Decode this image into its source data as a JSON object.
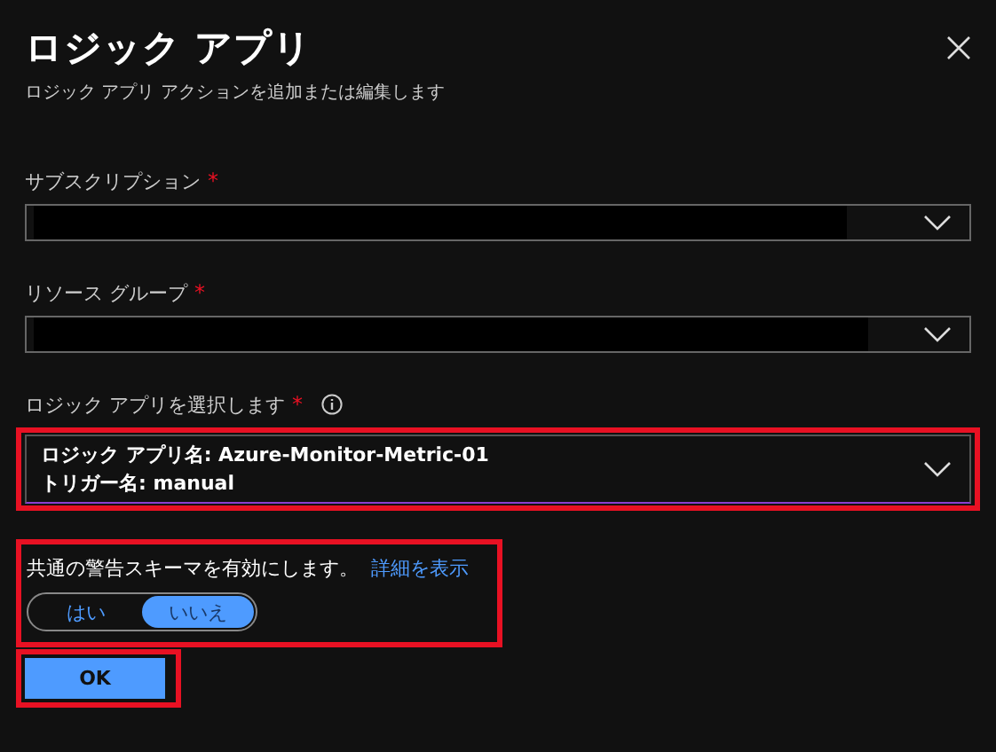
{
  "panel": {
    "title": "ロジック アプリ",
    "subtitle": "ロジック アプリ アクションを追加または編集します"
  },
  "fields": [
    {
      "label": "サブスクリプション",
      "required": "*",
      "redacted": true
    },
    {
      "label": "リソース グループ",
      "required": "*",
      "redacted": true
    },
    {
      "label": "ロジック アプリを選択します",
      "required": "*",
      "info": true,
      "lines": [
        "ロジック アプリ名: Azure-Monitor-Metric-01",
        "トリガー名: manual"
      ],
      "highlighted": true
    }
  ],
  "schema": {
    "text": "共通の警告スキーマを有効にします。",
    "link": "詳細を表示",
    "highlighted": true,
    "options": [
      {
        "label": "はい",
        "selected": false
      },
      {
        "label": "いいえ",
        "selected": true
      }
    ]
  },
  "ok_button": {
    "label": "OK",
    "highlighted": true
  }
}
